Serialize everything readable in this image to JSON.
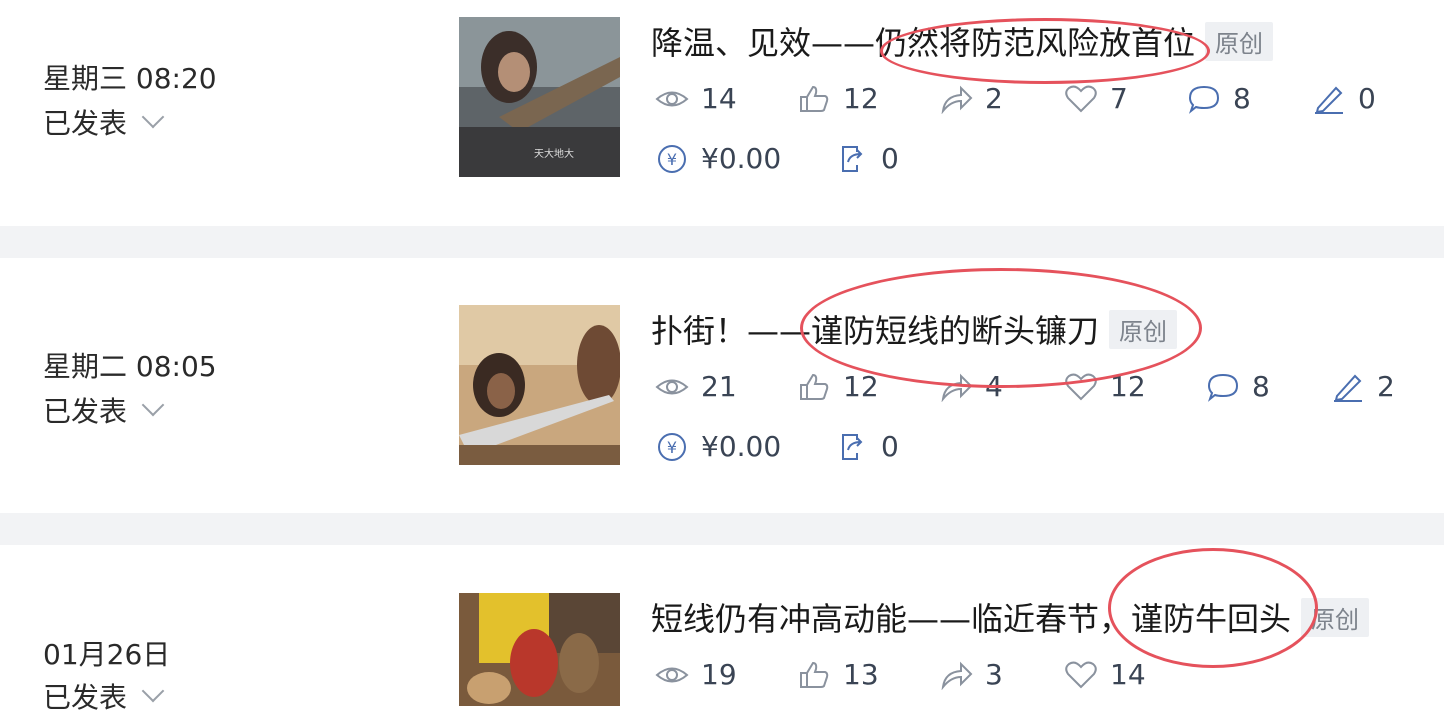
{
  "badge_label": "原创",
  "posts": [
    {
      "date": "星期三 08:20",
      "status": "已发表",
      "title": "降温、见效——仍然将防范风险放首位",
      "stats": {
        "views": "14",
        "likes": "12",
        "shares": "2",
        "favorites": "7",
        "comments": "8",
        "edits": "0"
      },
      "reward": "¥0.00",
      "forwards": "0"
    },
    {
      "date": "星期二 08:05",
      "status": "已发表",
      "title": "扑街！——谨防短线的断头镰刀",
      "stats": {
        "views": "21",
        "likes": "12",
        "shares": "4",
        "favorites": "12",
        "comments": "8",
        "edits": "2"
      },
      "reward": "¥0.00",
      "forwards": "0"
    },
    {
      "date": "01月26日",
      "status": "已发表",
      "title": "短线仍有冲高动能——临近春节，谨防牛回头",
      "stats": {
        "views": "19",
        "likes": "13",
        "shares": "3",
        "favorites": "14"
      }
    }
  ],
  "colors": {
    "annotation": "#e5525c",
    "icon": "#4a5566",
    "separator": "#f2f3f5"
  }
}
